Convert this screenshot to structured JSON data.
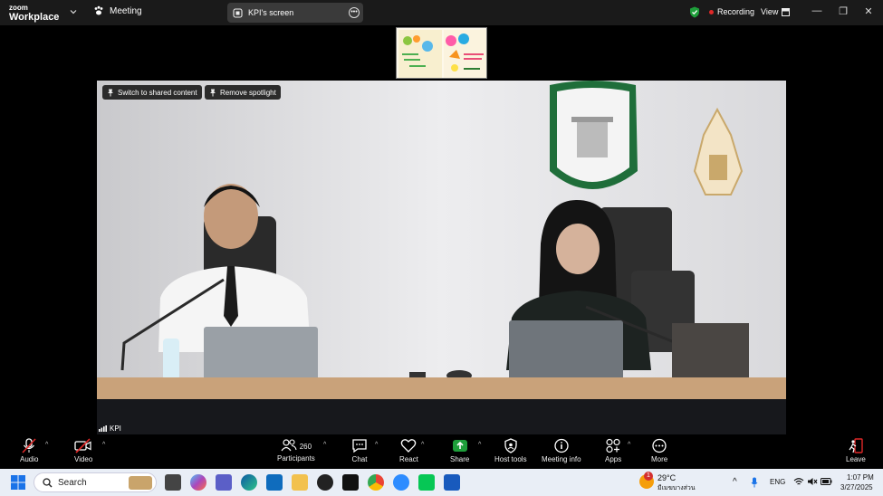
{
  "titlebar": {
    "logo_line1": "zoom",
    "logo_line2": "Workplace",
    "meeting_label": "Meeting",
    "screen_tab_label": "KPI's screen",
    "recording_label": "Recording",
    "view_label": "View"
  },
  "video": {
    "switch_label": "Switch to shared content",
    "remove_spotlight_label": "Remove spotlight",
    "participant_name": "KPI"
  },
  "toolbar": {
    "audio": "Audio",
    "video": "Video",
    "participants": "Participants",
    "participants_count": "260",
    "chat": "Chat",
    "react": "React",
    "share": "Share",
    "host_tools": "Host tools",
    "meeting_info": "Meeting info",
    "apps": "Apps",
    "more": "More",
    "leave": "Leave"
  },
  "taskbar": {
    "search_label": "Search",
    "weather_temp": "29°C",
    "weather_desc": "มีเมฆบางส่วน",
    "weather_badge": "1",
    "lang": "ENG",
    "time": "1:07 PM",
    "date": "3/27/2025"
  },
  "colors": {
    "accent_green": "#1e9e3a",
    "record_red": "#e02828",
    "leave_red": "#e02828"
  }
}
